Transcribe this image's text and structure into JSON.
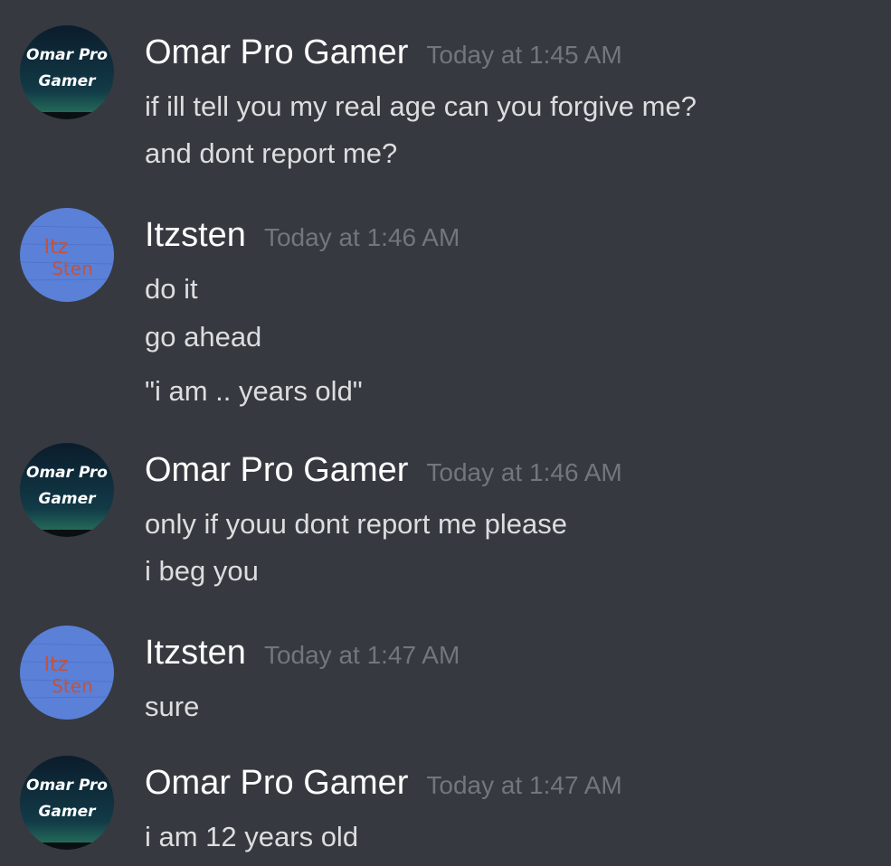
{
  "messages": [
    {
      "author": "Omar Pro Gamer",
      "avatar": "omar-avatar",
      "timestamp": "Today at 1:45 AM",
      "lines": [
        "if ill tell you my real age can you forgive me?",
        "and dont report me?"
      ]
    },
    {
      "author": "Itzsten",
      "avatar": "itzsten-avatar",
      "timestamp": "Today at 1:46 AM",
      "lines": [
        "do it",
        "go ahead",
        "\"i am .. years old\""
      ]
    },
    {
      "author": "Omar Pro Gamer",
      "avatar": "omar-avatar",
      "timestamp": "Today at 1:46 AM",
      "lines": [
        "only if youu dont report me please",
        "i beg you"
      ]
    },
    {
      "author": "Itzsten",
      "avatar": "itzsten-avatar",
      "timestamp": "Today at 1:47 AM",
      "lines": [
        "sure"
      ]
    },
    {
      "author": "Omar Pro Gamer",
      "avatar": "omar-avatar",
      "timestamp": "Today at 1:47 AM",
      "lines": [
        "i am 12 years old"
      ]
    }
  ],
  "avatars": {
    "omar": {
      "text_line1": "Omar Pro",
      "text_line2": "Gamer",
      "bg_top": "#0b1c2c",
      "bg_bottom": "#1f6a5e"
    },
    "itzsten": {
      "text_line1": "Itz",
      "text_line2": "Sten",
      "bg": "#5a7fd6",
      "scribble": "#c0533f"
    }
  },
  "colors": {
    "background": "#36393f",
    "username": "#ffffff",
    "timestamp": "#72767d",
    "message_text": "#dcddde"
  }
}
